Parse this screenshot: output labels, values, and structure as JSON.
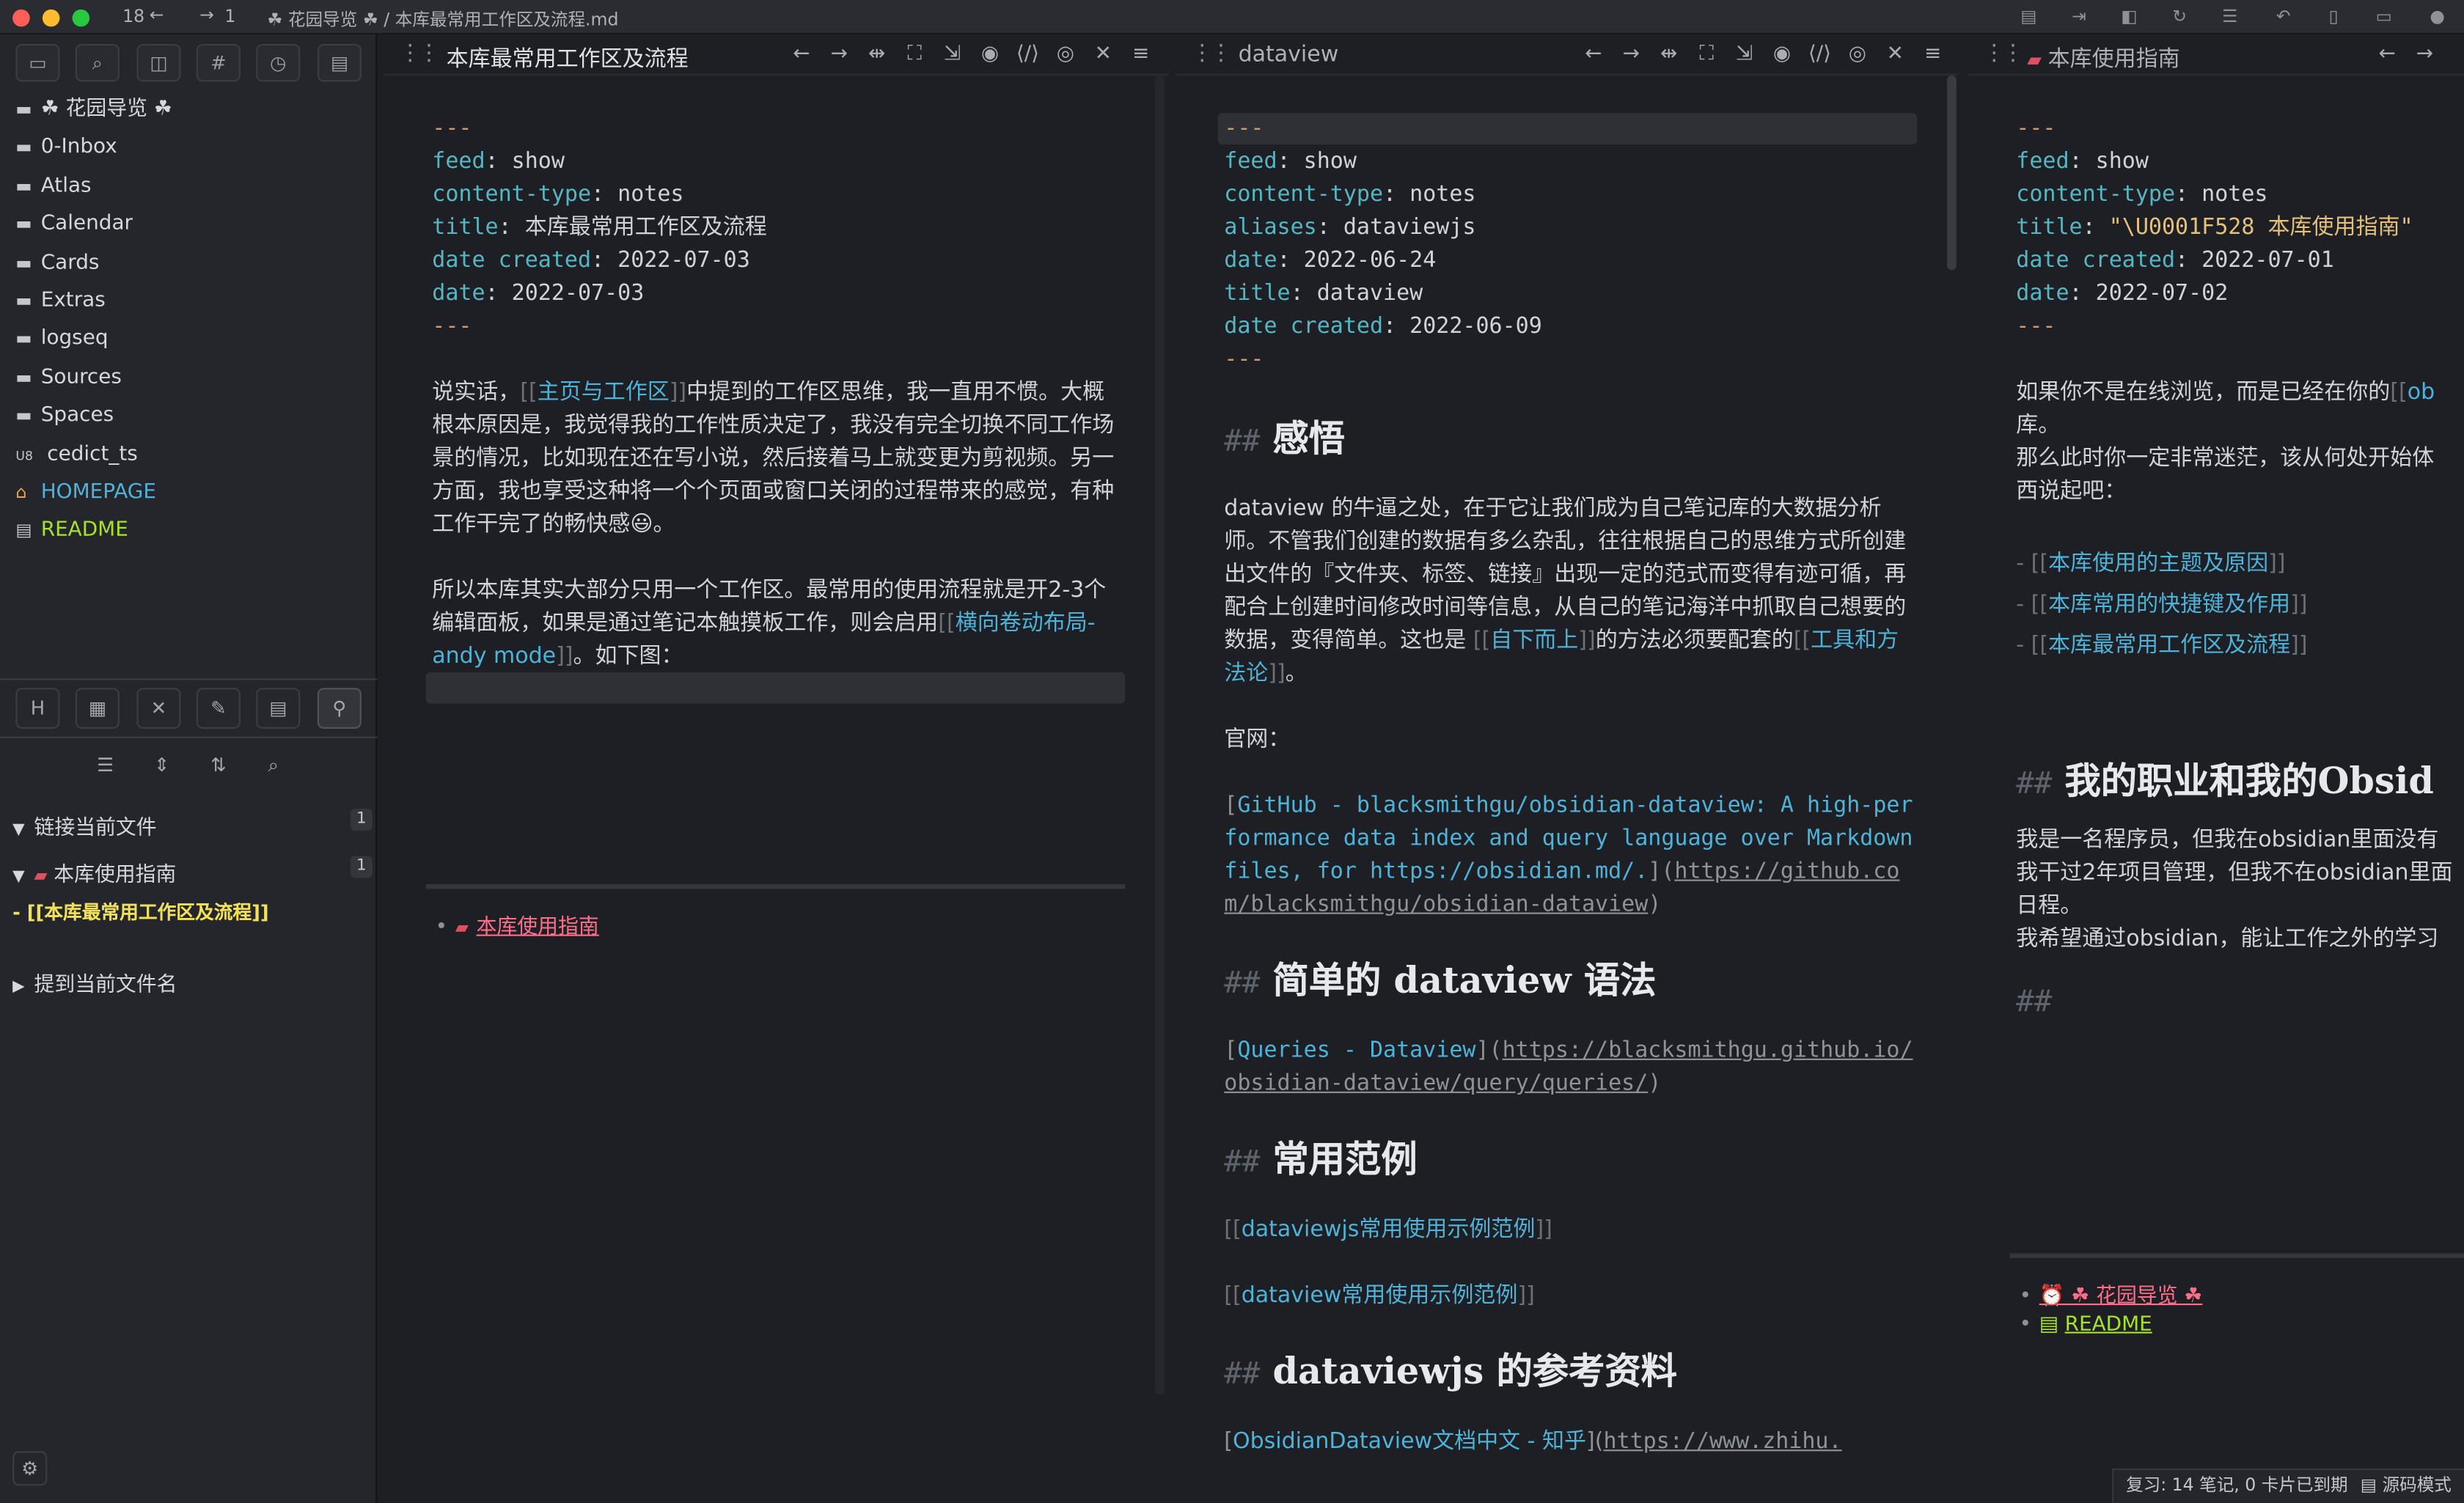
{
  "titlebar": {
    "back_count": "18",
    "forward_count": "1",
    "path_prefix": "☘ 花园导览 ☘ / ",
    "path_file": "本库最常用工作区及流程.md"
  },
  "sidebar": {
    "tabs": [
      "files-icon",
      "search-icon",
      "bookmark-icon",
      "tag-icon",
      "history-icon",
      "notebook-icon"
    ],
    "tree": [
      {
        "icon": "▬",
        "label": "☘ 花园导览 ☘",
        "color": "#d6d8dd"
      },
      {
        "icon": "▬",
        "label": "0-Inbox",
        "color": "#d6d8dd"
      },
      {
        "icon": "▬",
        "label": "Atlas",
        "color": "#d6d8dd"
      },
      {
        "icon": "▬",
        "label": "Calendar",
        "color": "#d6d8dd"
      },
      {
        "icon": "▬",
        "label": "Cards",
        "color": "#d6d8dd"
      },
      {
        "icon": "▬",
        "label": "Extras",
        "color": "#d6d8dd"
      },
      {
        "icon": "▬",
        "label": "logseq",
        "color": "#d6d8dd"
      },
      {
        "icon": "▬",
        "label": "Sources",
        "color": "#d6d8dd"
      },
      {
        "icon": "▬",
        "label": "Spaces",
        "color": "#d6d8dd"
      },
      {
        "icon": "U8",
        "label": "cedict_ts",
        "color": "#d6d8dd"
      },
      {
        "icon": "⌂",
        "label": "HOMEPAGE",
        "color": "#4db3d8"
      },
      {
        "icon": "▤",
        "label": "README",
        "color": "#a6e22e"
      }
    ],
    "tools_row1": [
      "H",
      "▦",
      "✕",
      "✎",
      "▤",
      "⚲"
    ],
    "tools_row2": [
      "☰",
      "⇕",
      "⇅",
      "⌕"
    ],
    "linked_title": "链接当前文件",
    "linked_count": "1",
    "linked_file": "本库使用指南",
    "linked_file_count": "1",
    "linked_line": "- [[本库最常用工作区及流程]]",
    "unlinked_title": "提到当前文件名",
    "settings_icon": "⚙"
  },
  "pane1": {
    "title": "本库最常用工作区及流程",
    "fm_dash": "---",
    "fm": [
      {
        "key": "feed",
        "val": "show"
      },
      {
        "key": "content-type",
        "val": "notes"
      },
      {
        "key": "title",
        "val": "本库最常用工作区及流程"
      },
      {
        "key": "date created",
        "val": "2022-07-03"
      },
      {
        "key": "date",
        "val": "2022-07-03"
      }
    ],
    "p1_a": "说实话，",
    "p1_link": "主页与工作区",
    "p1_b": "中提到的工作区思维，我一直用不惯。大概根本原因是，我觉得我的工作性质决定了，我没有完全切换不同工作场景的情况，比如现在还在写小说，然后接着马上就变更为剪视频。另一方面，我也享受这种将一个个页面或窗口关闭的过程带来的感觉，有种工作干完了的畅快感😃。",
    "p2_a": "所以本库其实大部分只用一个工作区。最常用的使用流程就是开2-3个编辑面板，如果是通过笔记本触摸板工作，则会启用",
    "p2_link": "横向卷动布局- andy mode",
    "p2_b": "。如下图：",
    "backlink": "本库使用指南"
  },
  "pane2": {
    "title": "dataview",
    "fm_dash": "---",
    "fm": [
      {
        "key": "feed",
        "val": "show"
      },
      {
        "key": "content-type",
        "val": "notes"
      },
      {
        "key": "aliases",
        "val": "dataviewjs"
      },
      {
        "key": "date",
        "val": "2022-06-24"
      },
      {
        "key": "title",
        "val": "dataview"
      },
      {
        "key": "date created",
        "val": "2022-06-09"
      }
    ],
    "h_ganwu": "感悟",
    "p1_a": "dataview 的牛逼之处，在于它让我们成为自己笔记库的大数据分析师。不管我们创建的数据有多么杂乱，往往根据自己的思维方式所创建出文件的『文件夹、标签、链接』出现一定的范式而变得有迹可循，再配合上创建时间修改时间等信息，从自己的笔记海洋中抓取自己想要的数据，变得简单。这也是 ",
    "p1_link1": "自下而上",
    "p1_b": "的方法必须要配套的",
    "p1_link2": "工具和方法论",
    "p1_c": "。",
    "official": "官网：",
    "gh_text": "GitHub - blacksmithgu/obsidian-dataview: A high-performance data index and query language over Markdown files, for https://obsidian.md/.",
    "gh_url": "https://github.com/blacksmithgu/obsidian-dataview",
    "h_syntax": "简单的 dataview 语法",
    "q_text": "Queries - Dataview",
    "q_url": "https://blacksmithgu.github.io/obsidian-dataview/query/queries/",
    "h_examples": "常用范例",
    "ex1": "dataviewjs常用使用示例范例",
    "ex2": "dataview常用使用示例范例",
    "h_refs": "dataviewjs 的参考资料",
    "ref_text": "ObsidianDataview文档中文 - 知乎",
    "ref_url": "https://www.zhihu."
  },
  "pane3": {
    "title": "本库使用指南",
    "fm_dash": "---",
    "fm": [
      {
        "key": "feed",
        "val": "show"
      },
      {
        "key": "content-type",
        "val": "notes"
      },
      {
        "key": "title",
        "val": "\"\\U0001F528 本库使用指南\""
      },
      {
        "key": "date created",
        "val": "2022-07-01"
      },
      {
        "key": "date",
        "val": "2022-07-02"
      }
    ],
    "p1_a": "如果你不是在线浏览，而是已经在你的",
    "p1_link": "ob",
    "p1_b": "库。",
    "p2": "那么此时你一定非常迷茫，该从何处开始体",
    "p3": "西说起吧：",
    "list": [
      "本库使用的主题及原因",
      "本库常用的快捷键及作用",
      "本库最常用工作区及流程"
    ],
    "h_job": "我的职业和我的Obsid",
    "j1": "我是一名程序员，但我在obsidian里面没有",
    "j2": "我干过2年项目管理，但我不在obsidian里面",
    "j3": "日程。",
    "j4": "我希望通过obsidian，能让工作之外的学习",
    "backlinks": [
      "⏰ ☘ 花园导览 ☘",
      "README"
    ]
  },
  "status": {
    "text": "复习: 14 笔记, 0 卡片已到期",
    "mode": "源码模式"
  },
  "colors": {
    "accent": "#4db3d8",
    "frontmatter_key": "#56b6c2",
    "string": "#e5c07b",
    "readme": "#a6e22e",
    "backlink": "#ff6f8a"
  }
}
